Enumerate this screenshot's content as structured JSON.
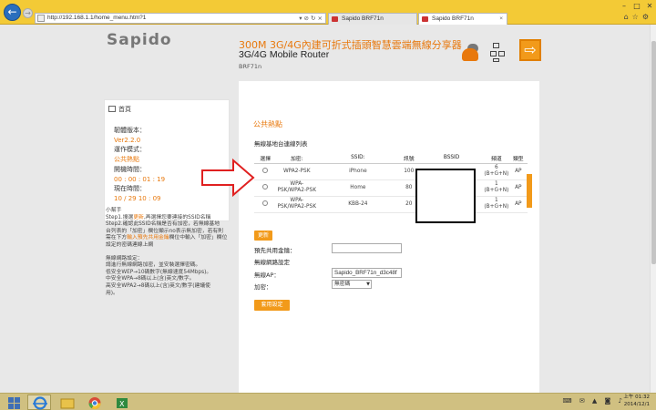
{
  "browser": {
    "url": "http://192.168.1.1/home_menu.htm?1",
    "address_tools": "▾ ⊘ ↻ ×",
    "tabs": [
      {
        "label": "Sapido BRF71n"
      },
      {
        "label": "Sapido BRF71n"
      }
    ],
    "window_controls": [
      "–",
      "□",
      "✕"
    ]
  },
  "header": {
    "logo": "Sapido",
    "title": "300M 3G/4G內建可折式插頭智慧雲端無線分享器",
    "subtitle": "3G/4G Mobile Router",
    "model": "BRF71n"
  },
  "sidebar": {
    "home_label": "首頁",
    "firmware_label": "韌體版本：",
    "firmware_value": "Ver2.2.0",
    "mode_label": "運作模式：",
    "mode_value": "公共熱點",
    "uptime_label": "開機時間：",
    "uptime_value": "00 : 00 : 01 : 19",
    "time_label": "現在時間：",
    "time_value": "10 / 29  10 : 09"
  },
  "help": {
    "title": "小幫手",
    "line1a": "Step1.搜選",
    "line1b": "更新",
    "line1c": ",再選擇您要連接的SSID名稱",
    "line2": "Step2.確認此SSID名稱是否有加密，若無線基地",
    "line3": "台列表的「加密」欄位顯示no表示無加密，若有則",
    "line4a": "需在下方",
    "line4b": "輸入預先共用金鑰",
    "line4c": "欄位中輸入「加密」欄位",
    "line5": "設定的密碼連線上網",
    "line6": "",
    "line7": "無線網路設定：",
    "line8": "請進行無線網路加密，並安裝選擇密碼。",
    "line9": "低安全WEP→10碼數字(無線速度54Mbps)。",
    "line10": "中安全WPA→8碼以上(含)英文/數字。",
    "line11": "高安全WPA2→8碼以上(含)英文/數字(建議使",
    "line12": "用)。"
  },
  "main": {
    "title": "公共熱點",
    "ap_list_title": "無線基地台連線列表",
    "columns": [
      "選擇",
      "加密:",
      "SSID:",
      "訊號",
      "BSSID",
      "頻道",
      "類型"
    ],
    "rows": [
      {
        "enc": "WPA2-PSK",
        "ssid": "iPhone",
        "signal": "100",
        "bssid": "",
        "channel": "6 (B+G+N)",
        "type": "AP"
      },
      {
        "enc": "WPA-PSK/WPA2-PSK",
        "ssid": "Home",
        "signal": "80",
        "bssid": "",
        "channel": "1 (B+G+N)",
        "type": "AP"
      },
      {
        "enc": "WPA-PSK/WPA2-PSK",
        "ssid": "KBB-24",
        "signal": "20",
        "bssid": "",
        "channel": "1 (B+G+N)",
        "type": "AP"
      }
    ],
    "refresh_label": "更新",
    "psk_label": "預先共用金鑰：",
    "psk_value": "",
    "wireless_settings_title": "無線網路設定",
    "ap_label": "無線AP：",
    "ap_value": "Sapido_BRF71n_d3c48f",
    "enc_label": "加密：",
    "enc_value": "無密碼",
    "apply_label": "套用設定"
  },
  "taskbar": {
    "tray_icons": "⌨ ✉ ▲ ◙ ♪",
    "time": "上午 01:32",
    "date": "2014/12/1"
  },
  "colors": {
    "accent": "#e8780c",
    "button": "#f29a1a",
    "chrome": "#f3ca36"
  }
}
